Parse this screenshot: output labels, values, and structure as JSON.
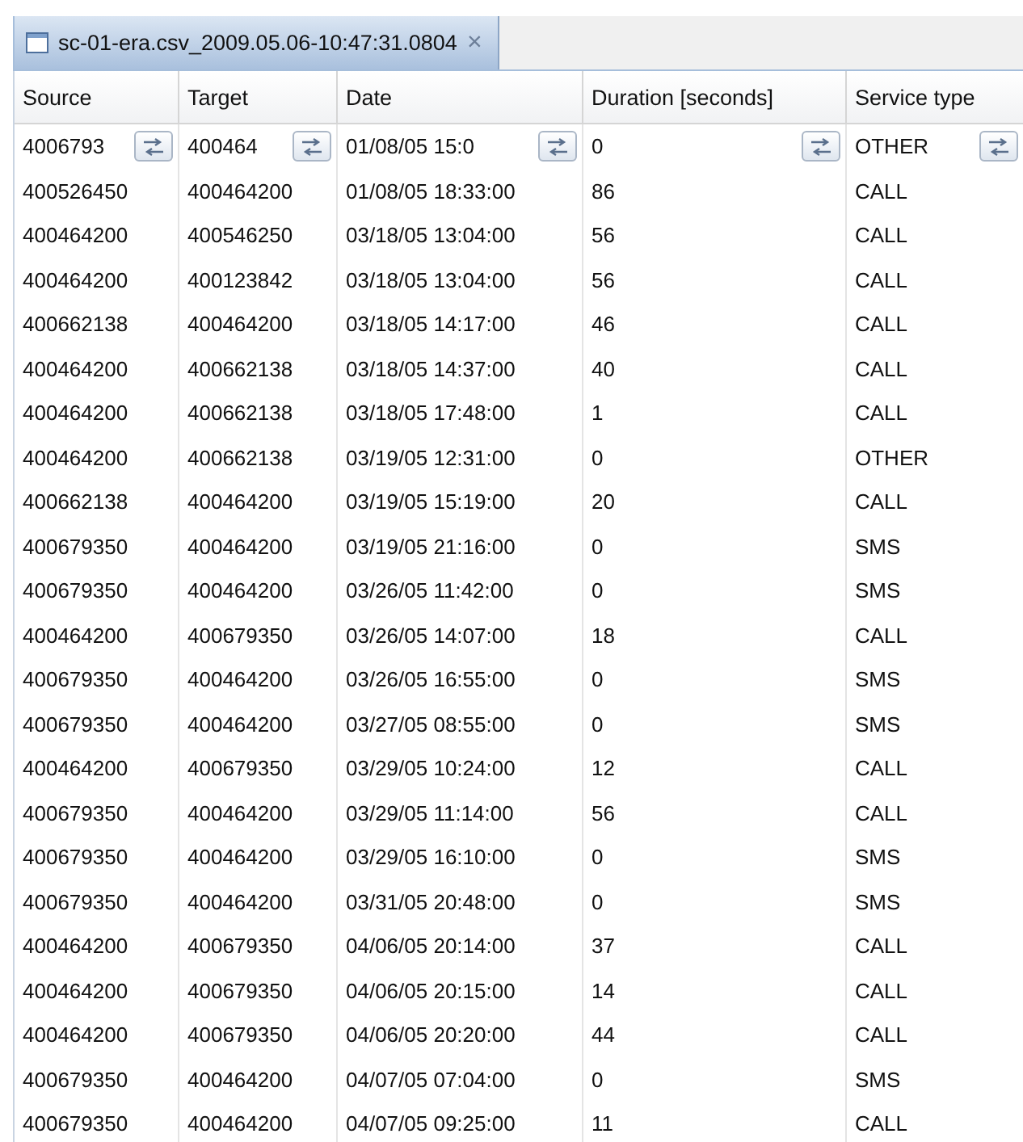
{
  "tab": {
    "title": "sc-01-era.csv_2009.05.06-10:47:31.0804",
    "close": "×"
  },
  "table": {
    "columns": [
      "Source",
      "Target",
      "Date",
      "Duration [seconds]",
      "Service type"
    ],
    "rows": [
      {
        "kind": "filter",
        "cells": [
          "4006793",
          "400464",
          "01/08/05 15:0",
          "0",
          "OTHER"
        ]
      },
      {
        "kind": "plain",
        "cells": [
          "400526450",
          "400464200",
          "01/08/05 18:33:00",
          "86",
          "CALL"
        ]
      },
      {
        "kind": "plain",
        "cells": [
          "400464200",
          "400546250",
          "03/18/05 13:04:00",
          "56",
          "CALL"
        ]
      },
      {
        "kind": "plain",
        "cells": [
          "400464200",
          "400123842",
          "03/18/05 13:04:00",
          "56",
          "CALL"
        ]
      },
      {
        "kind": "plain",
        "cells": [
          "400662138",
          "400464200",
          "03/18/05 14:17:00",
          "46",
          "CALL"
        ]
      },
      {
        "kind": "plain",
        "cells": [
          "400464200",
          "400662138",
          "03/18/05 14:37:00",
          "40",
          "CALL"
        ]
      },
      {
        "kind": "plain",
        "cells": [
          "400464200",
          "400662138",
          "03/18/05 17:48:00",
          "1",
          "CALL"
        ]
      },
      {
        "kind": "plain",
        "cells": [
          "400464200",
          "400662138",
          "03/19/05 12:31:00",
          "0",
          "OTHER"
        ]
      },
      {
        "kind": "plain",
        "cells": [
          "400662138",
          "400464200",
          "03/19/05 15:19:00",
          "20",
          "CALL"
        ]
      },
      {
        "kind": "plain",
        "cells": [
          "400679350",
          "400464200",
          "03/19/05 21:16:00",
          "0",
          "SMS"
        ]
      },
      {
        "kind": "plain",
        "cells": [
          "400679350",
          "400464200",
          "03/26/05 11:42:00",
          "0",
          "SMS"
        ]
      },
      {
        "kind": "plain",
        "cells": [
          "400464200",
          "400679350",
          "03/26/05 14:07:00",
          "18",
          "CALL"
        ]
      },
      {
        "kind": "plain",
        "cells": [
          "400679350",
          "400464200",
          "03/26/05 16:55:00",
          "0",
          "SMS"
        ]
      },
      {
        "kind": "plain",
        "cells": [
          "400679350",
          "400464200",
          "03/27/05 08:55:00",
          "0",
          "SMS"
        ]
      },
      {
        "kind": "plain",
        "cells": [
          "400464200",
          "400679350",
          "03/29/05 10:24:00",
          "12",
          "CALL"
        ]
      },
      {
        "kind": "plain",
        "cells": [
          "400679350",
          "400464200",
          "03/29/05 11:14:00",
          "56",
          "CALL"
        ]
      },
      {
        "kind": "plain",
        "cells": [
          "400679350",
          "400464200",
          "03/29/05 16:10:00",
          "0",
          "SMS"
        ]
      },
      {
        "kind": "plain",
        "cells": [
          "400679350",
          "400464200",
          "03/31/05 20:48:00",
          "0",
          "SMS"
        ]
      },
      {
        "kind": "plain",
        "cells": [
          "400464200",
          "400679350",
          "04/06/05 20:14:00",
          "37",
          "CALL"
        ]
      },
      {
        "kind": "plain",
        "cells": [
          "400464200",
          "400679350",
          "04/06/05 20:15:00",
          "14",
          "CALL"
        ]
      },
      {
        "kind": "plain",
        "cells": [
          "400464200",
          "400679350",
          "04/06/05 20:20:00",
          "44",
          "CALL"
        ]
      },
      {
        "kind": "plain",
        "cells": [
          "400679350",
          "400464200",
          "04/07/05 07:04:00",
          "0",
          "SMS"
        ]
      },
      {
        "kind": "plain",
        "cells": [
          "400679350",
          "400464200",
          "04/07/05 09:25:00",
          "11",
          "CALL"
        ]
      }
    ]
  }
}
